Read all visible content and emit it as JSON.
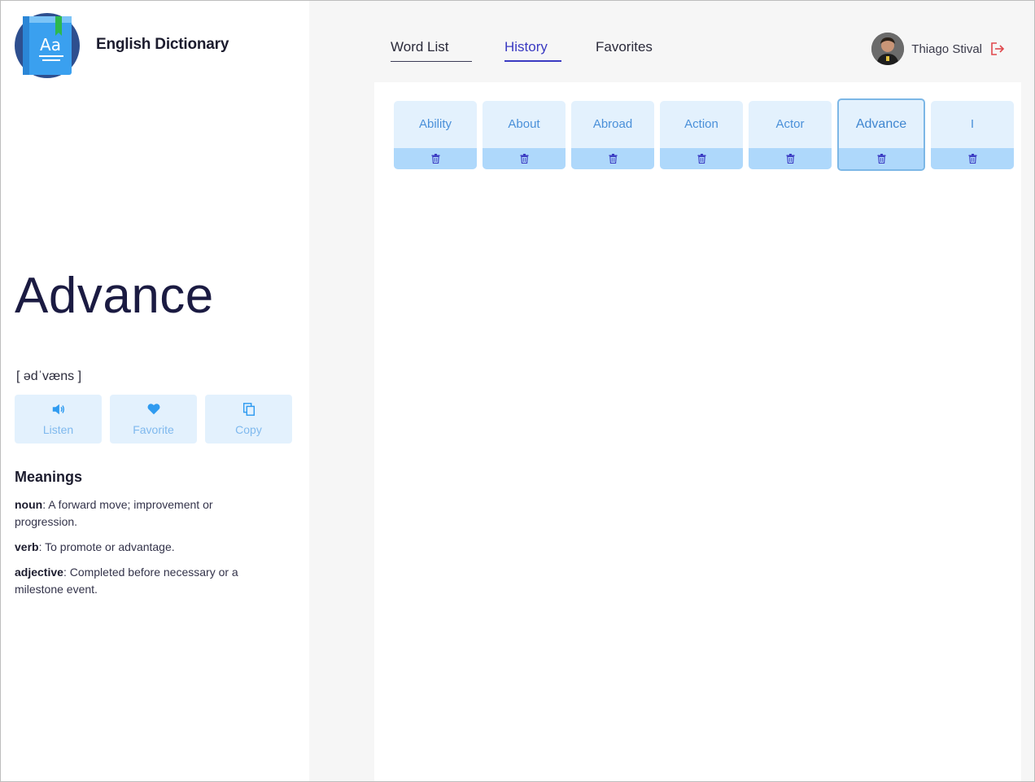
{
  "app": {
    "title": "English Dictionary",
    "logo_text": "Aa"
  },
  "word": {
    "text": "Advance",
    "phonetic": "[ ədˈvæns ]"
  },
  "actions": [
    {
      "label": "Listen",
      "icon": "speaker-icon"
    },
    {
      "label": "Favorite",
      "icon": "heart-icon"
    },
    {
      "label": "Copy",
      "icon": "copy-icon"
    }
  ],
  "meanings": {
    "title": "Meanings",
    "items": [
      {
        "pos": "noun",
        "definition": ": A forward move; improvement or progression."
      },
      {
        "pos": "verb",
        "definition": ": To promote or advantage."
      },
      {
        "pos": "adjective",
        "definition": ": Completed before necessary or a milestone event."
      }
    ]
  },
  "nav": {
    "tabs": [
      {
        "label": "Word List",
        "active": false
      },
      {
        "label": "History",
        "active": true
      },
      {
        "label": "Favorites",
        "active": false
      }
    ]
  },
  "user": {
    "name": "Thiago Stival"
  },
  "history": {
    "words": [
      "Ability",
      "About",
      "Abroad",
      "Action",
      "Actor",
      "Advance",
      "I"
    ],
    "selected": "Advance"
  },
  "colors": {
    "accent": "#3a3ac2",
    "card_bg": "#e3f1fd",
    "card_delete_bg": "#aed8fb",
    "logout": "#e0484d",
    "icon_blue": "#2f9bf0"
  }
}
